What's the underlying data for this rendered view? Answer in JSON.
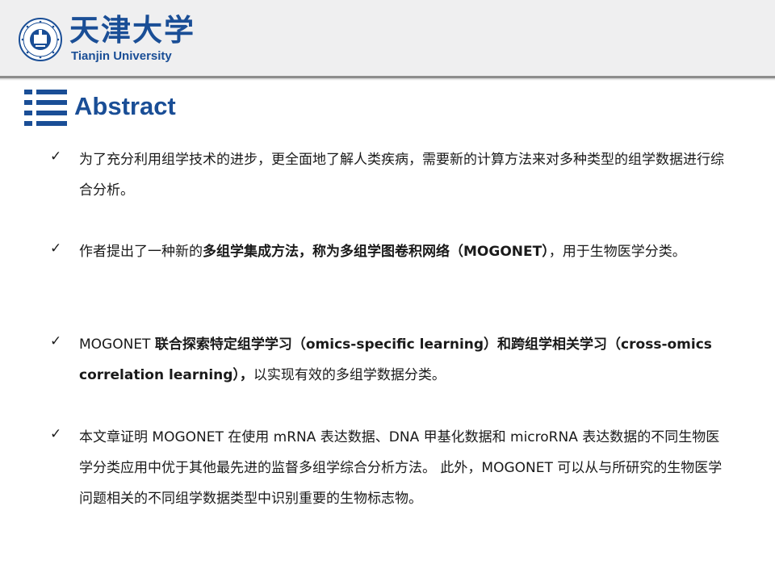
{
  "header": {
    "logo_cn": "天津大学",
    "logo_en": "Tianjin University"
  },
  "section": {
    "title": "Abstract",
    "icon": "list-title-icon"
  },
  "bullets": [
    {
      "icon": "check-icon",
      "mark": "✓",
      "segments": [
        {
          "text": "为了充分利用组学技术的进步，更全面地了解人类疾病，需要新的计算方法来对多种类型的组学数据进行综合分析。",
          "bold": false
        }
      ]
    },
    {
      "icon": "check-icon",
      "mark": "✓",
      "segments": [
        {
          "text": "作者提出了一种新的",
          "bold": false
        },
        {
          "text": "多组学集成方法，称为多组学图卷积网络（MOGONET）",
          "bold": true
        },
        {
          "text": "，用于生物医学分类。",
          "bold": false
        }
      ]
    },
    {
      "icon": "check-icon",
      "mark": "✓",
      "segments": [
        {
          "text": "MOGONET ",
          "bold": false
        },
        {
          "text": "联合探索特定组学学习（omics-specific learning）和跨组学相关学习（cross-omics correlation learning），",
          "bold": true
        },
        {
          "text": "以实现有效的多组学数据分类。",
          "bold": false
        }
      ]
    },
    {
      "icon": "check-icon",
      "mark": "✓",
      "segments": [
        {
          "text": "本文章证明 MOGONET 在使用 mRNA 表达数据、DNA 甲基化数据和 microRNA 表达数据的不同生物医学分类应用中优于其他最先进的监督多组学综合分析方法。 此外，MOGONET 可以从与所研究的生物医学问题相关的不同组学数据类型中识别重要的生物标志物。",
          "bold": false
        }
      ]
    }
  ],
  "colors": {
    "brand_blue": "#1a4e96",
    "header_bg": "#efeff0",
    "header_rule": "#8d8d8d"
  }
}
